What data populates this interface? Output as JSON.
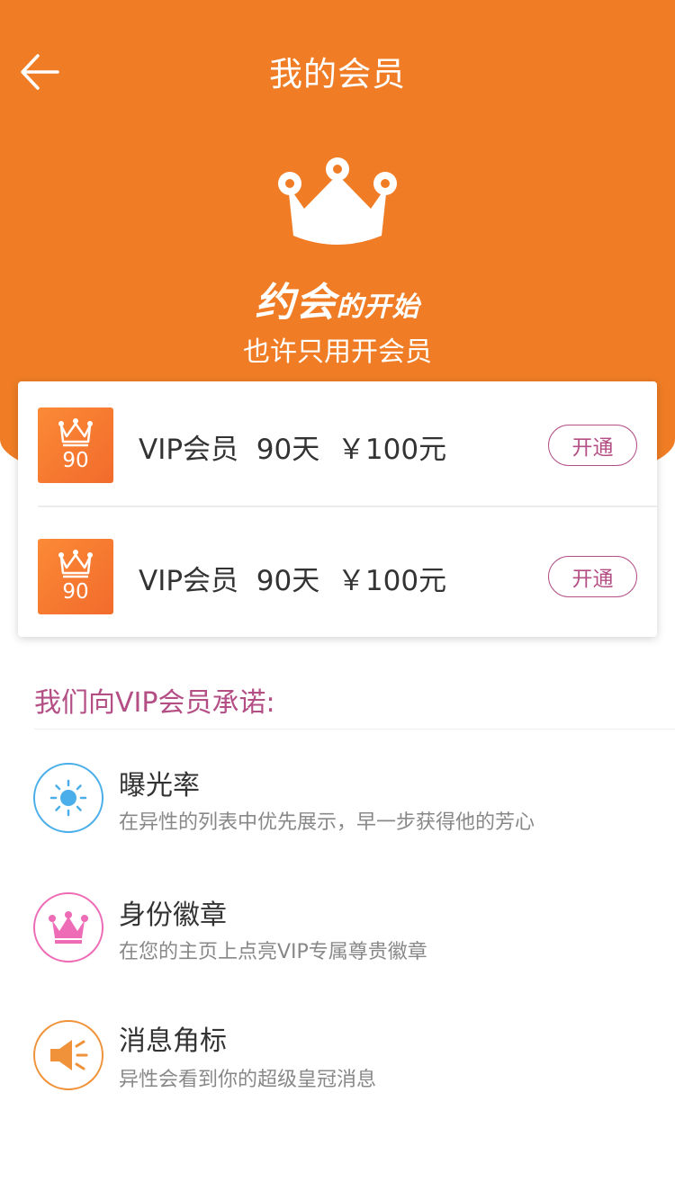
{
  "header": {
    "title": "我的会员",
    "slogan_big_1": "约会",
    "slogan_small": "的开始",
    "slogan_sub": "也许只用开会员"
  },
  "plans": [
    {
      "badge_days": "90",
      "text": "VIP会员  90天  ￥100元",
      "button": "开通"
    },
    {
      "badge_days": "90",
      "text": "VIP会员  90天  ￥100元",
      "button": "开通"
    }
  ],
  "promise": {
    "title": "我们向VIP会员承诺:",
    "features": [
      {
        "title": "曝光率",
        "desc": "在异性的列表中优先展示，早一步获得他的芳心",
        "icon": "sun-icon",
        "color": "#4AAEEA"
      },
      {
        "title": "身份徽章",
        "desc": "在您的主页上点亮VIP专属尊贵徽章",
        "icon": "crown-icon",
        "color": "#EE6BB5"
      },
      {
        "title": "消息角标",
        "desc": "异性会看到你的超级皇冠消息",
        "icon": "megaphone-icon",
        "color": "#F0923A"
      }
    ]
  },
  "colors": {
    "header_orange": "#F07D25",
    "accent_purple": "#B44F86"
  }
}
